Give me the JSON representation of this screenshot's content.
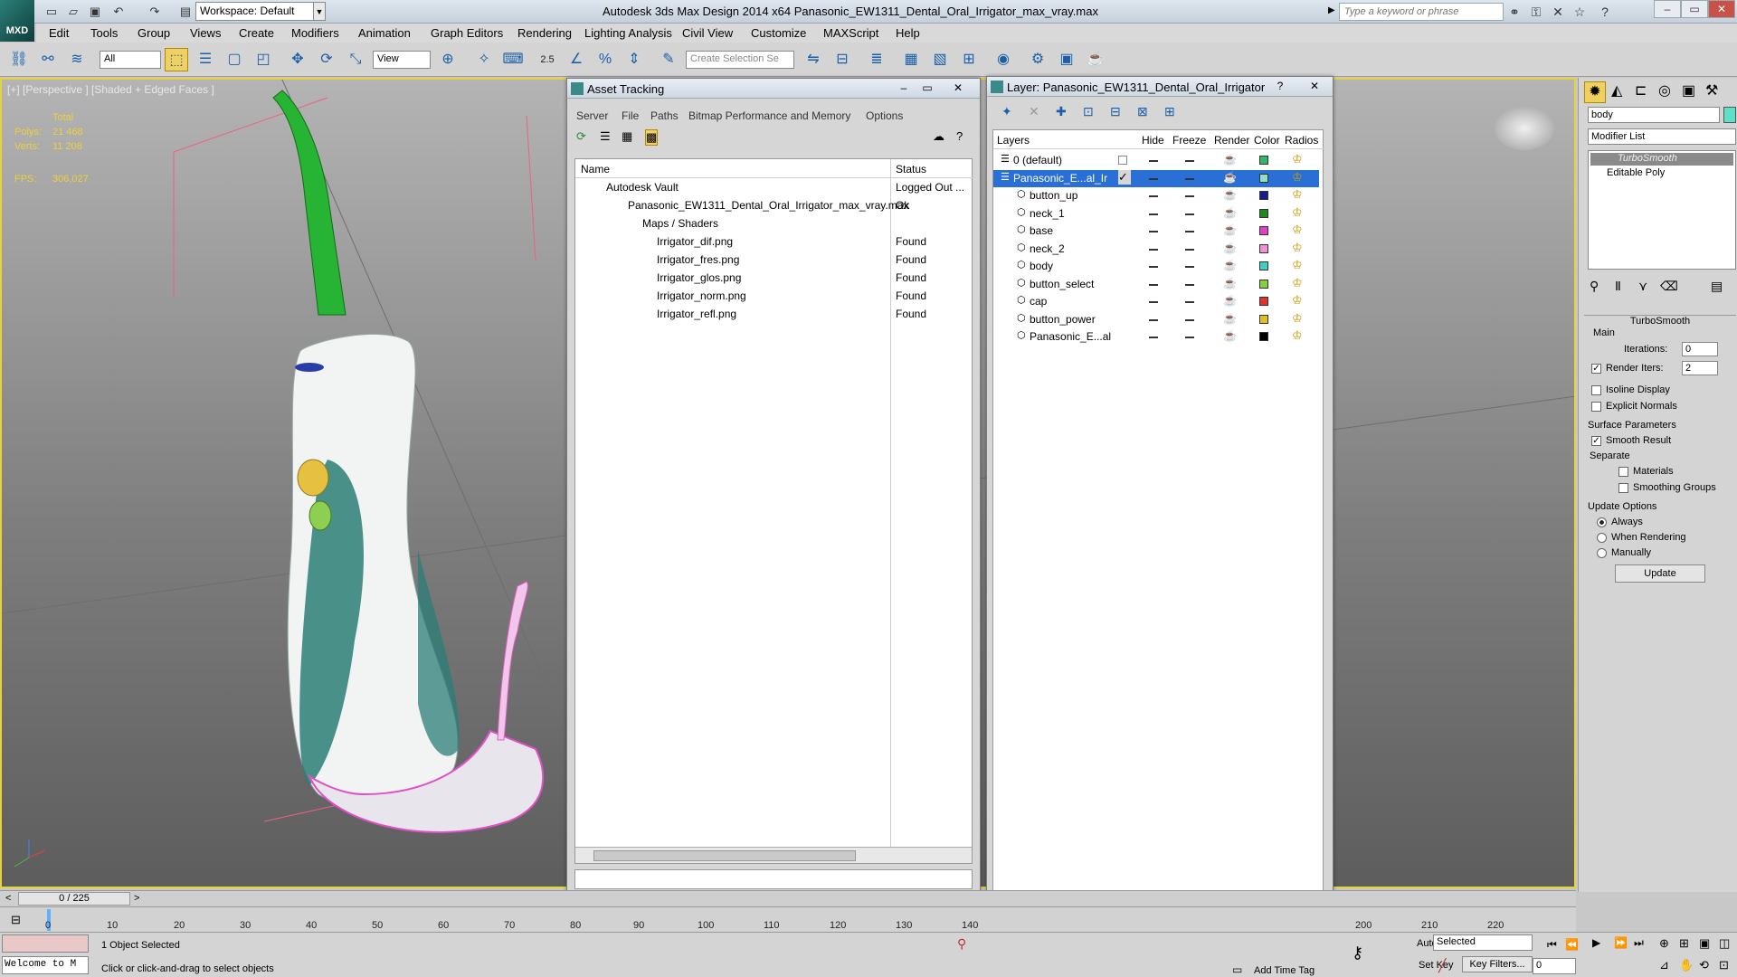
{
  "app": {
    "logo": "MXD",
    "workspace": "Workspace: Default",
    "title": "Autodesk 3ds Max Design 2014 x64     Panasonic_EW1311_Dental_Oral_Irrigator_max_vray.max",
    "search_placeholder": "Type a keyword or phrase"
  },
  "menu": [
    "Edit",
    "Tools",
    "Group",
    "Views",
    "Create",
    "Modifiers",
    "Animation",
    "Graph Editors",
    "Rendering",
    "Lighting Analysis",
    "Civil View",
    "Customize",
    "MAXScript",
    "Help"
  ],
  "toolbar": {
    "filter": "All",
    "refcoord": "View",
    "snap_value": "2.5",
    "selection_set_placeholder": "Create Selection Se"
  },
  "viewport": {
    "label": "[+] [Perspective ] [Shaded + Edged Faces ]",
    "stats_header": "Total",
    "polys_label": "Polys:",
    "polys_value": "21 468",
    "verts_label": "Verts:",
    "verts_value": "11 208",
    "fps_label": "FPS:",
    "fps_value": "306,027"
  },
  "asset_tracking": {
    "title": "Asset Tracking",
    "menu": [
      "Server",
      "File",
      "Paths",
      "Bitmap Performance and Memory",
      "Options"
    ],
    "col_name": "Name",
    "col_status": "Status",
    "rows": [
      {
        "name": "Autodesk Vault",
        "status": "Logged Out ..."
      },
      {
        "name": "Panasonic_EW1311_Dental_Oral_Irrigator_max_vray.max",
        "status": "Ok"
      },
      {
        "name": "Maps / Shaders",
        "status": ""
      },
      {
        "name": "Irrigator_dif.png",
        "status": "Found"
      },
      {
        "name": "Irrigator_fres.png",
        "status": "Found"
      },
      {
        "name": "Irrigator_glos.png",
        "status": "Found"
      },
      {
        "name": "Irrigator_norm.png",
        "status": "Found"
      },
      {
        "name": "Irrigator_refl.png",
        "status": "Found"
      }
    ]
  },
  "layer_manager": {
    "title": "Layer: Panasonic_EW1311_Dental_Oral_Irrigator",
    "cols": [
      "Layers",
      "Hide",
      "Freeze",
      "Render",
      "Color",
      "Radios"
    ],
    "layers": [
      {
        "name": "0 (default)",
        "color": "#2fb86a"
      },
      {
        "name": "Panasonic_E...al_Ir",
        "color": "#8fe0c8"
      },
      {
        "name": "button_up",
        "color": "#1a1a8c"
      },
      {
        "name": "neck_1",
        "color": "#1e8a1e"
      },
      {
        "name": "base",
        "color": "#e040c8"
      },
      {
        "name": "neck_2",
        "color": "#f090d8"
      },
      {
        "name": "body",
        "color": "#40d0c0"
      },
      {
        "name": "button_select",
        "color": "#80d040"
      },
      {
        "name": "cap",
        "color": "#e03030"
      },
      {
        "name": "button_power",
        "color": "#e0c020"
      },
      {
        "name": "Panasonic_E...al",
        "color": "#000000"
      }
    ]
  },
  "command_panel": {
    "object_name": "body",
    "modifier_list": "Modifier List",
    "stack": [
      "TurboSmooth",
      "Editable Poly"
    ],
    "rollout_title": "TurboSmooth",
    "main_label": "Main",
    "iterations_label": "Iterations:",
    "iterations_value": "0",
    "render_iters_label": "Render Iters:",
    "render_iters_value": "2",
    "isoline": "Isoline Display",
    "explicit": "Explicit Normals",
    "surface_params": "Surface Parameters",
    "smooth_result": "Smooth Result",
    "separate": "Separate",
    "materials": "Materials",
    "smoothing_groups": "Smoothing Groups",
    "update_options": "Update Options",
    "always": "Always",
    "when_rendering": "When Rendering",
    "manually": "Manually",
    "update_button": "Update"
  },
  "timeline": {
    "frame": "0 / 225",
    "ticks": [
      "0",
      "10",
      "20",
      "30",
      "40",
      "50",
      "60",
      "70",
      "80",
      "90",
      "100",
      "110",
      "120",
      "130",
      "140",
      "200",
      "210",
      "220"
    ]
  },
  "status": {
    "listener": "Welcome to M",
    "selected": "1 Object Selected",
    "prompt": "Click or click-and-drag to select objects",
    "add_time_tag": "Add Time Tag",
    "auto_key": "Auto Key",
    "set_key": "Set Key",
    "selected_dropdown": "Selected",
    "key_filters": "Key Filters...",
    "frame_value": "0"
  }
}
